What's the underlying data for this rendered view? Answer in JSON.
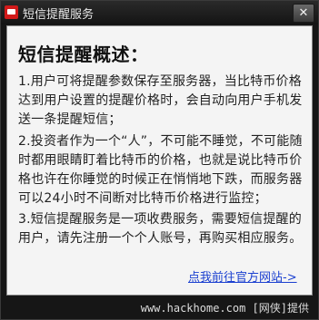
{
  "window": {
    "title": "短信提醒服务",
    "close_glyph": "✕"
  },
  "panel": {
    "heading": "短信提醒概述：",
    "paragraphs": [
      "1.用户可将提醒参数保存至服务器，当比特币价格达到用户设置的提醒价格时，会自动向用户手机发送一条提醒短信；",
      "2.投资者作为一个“人”，不可能不睡觉，不可能随时都用眼睛盯着比特币的价格，也就是说比特币价格也许在你睡觉的时候正在悄悄地下跌，而服务器可以24小时不间断对比特币价格进行监控；",
      "3.短信提醒服务是一项收费服务，需要短信提醒的用户，请先注册一个个人账号，再购买相应服务。"
    ],
    "link_text": "点我前往官方网站->"
  },
  "footer": {
    "watermark": "www.hackhome.com [网侠]提供"
  },
  "colors": {
    "accent_red": "#d21a1a",
    "link_blue": "#1a3fd0"
  },
  "icons": {
    "app": "sms-app-icon",
    "close": "close-icon"
  }
}
